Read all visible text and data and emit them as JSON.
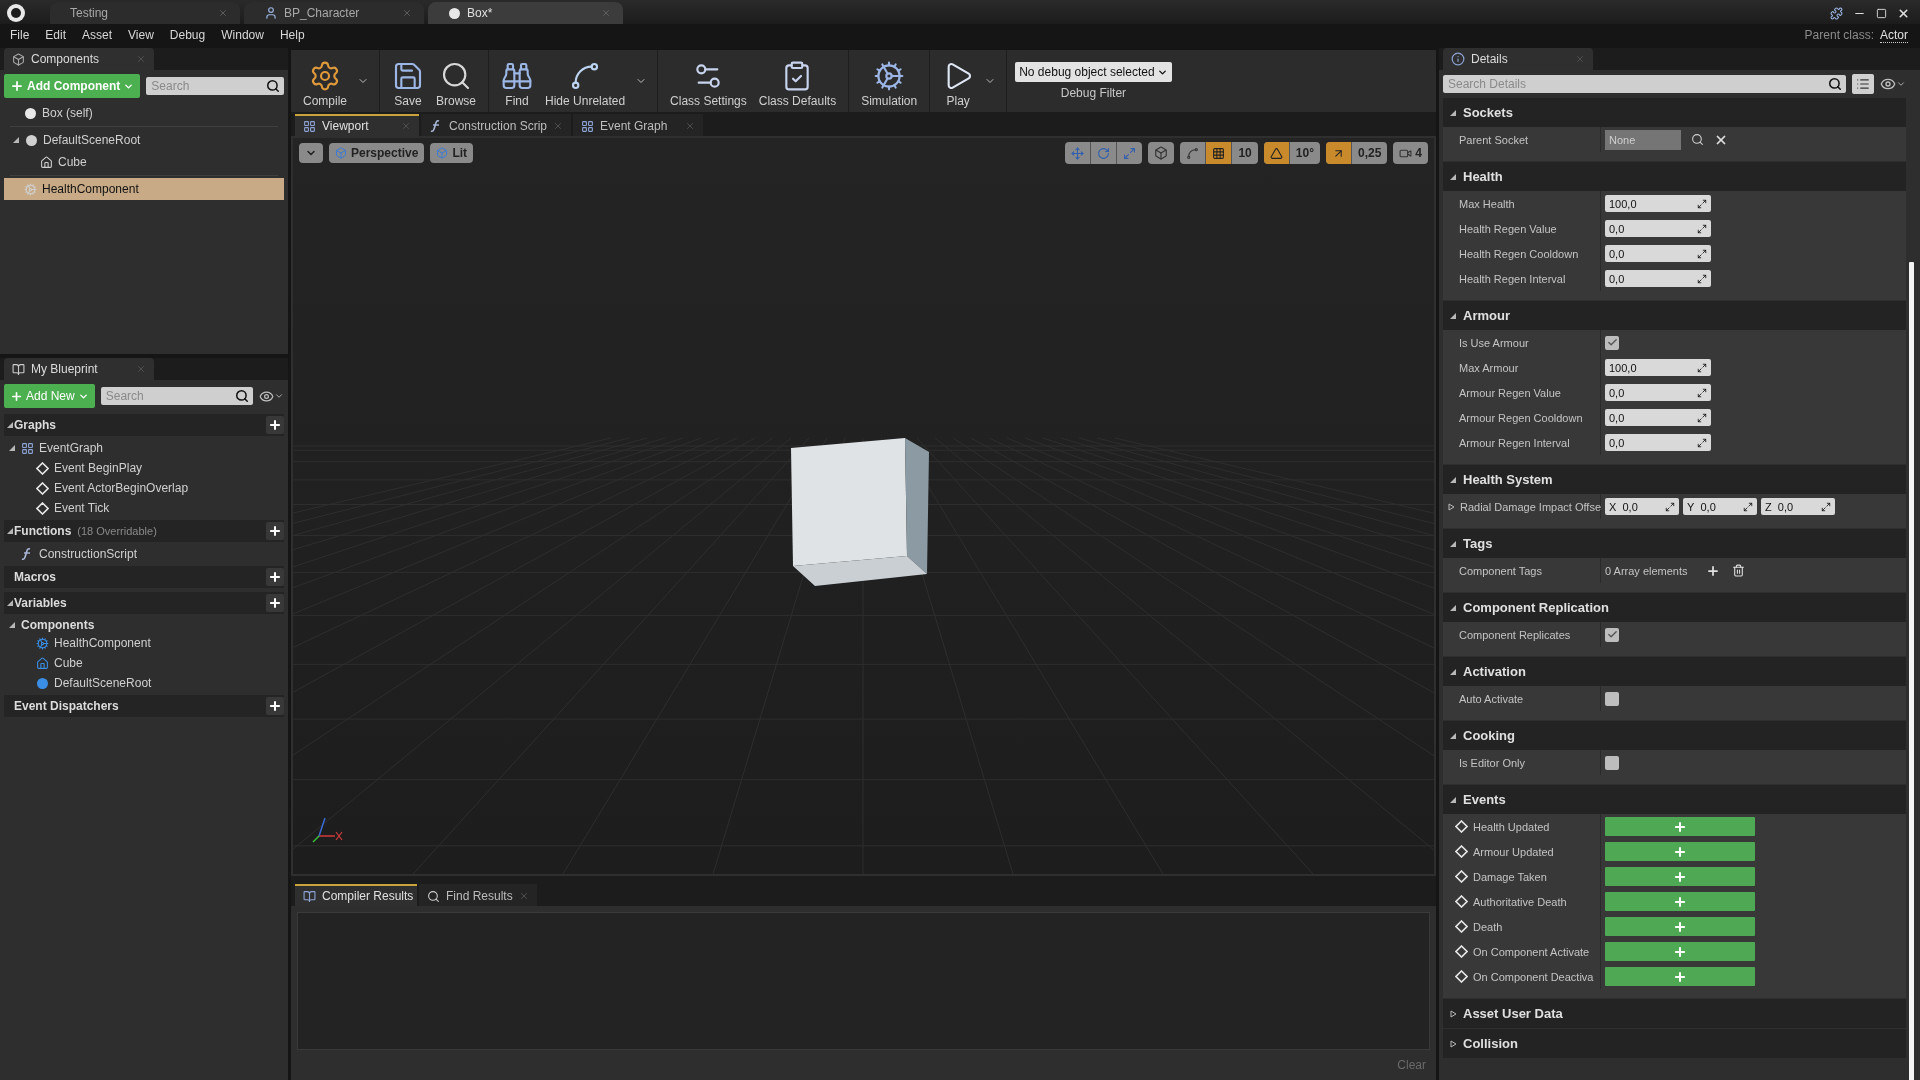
{
  "title_bar": {
    "tabs": [
      {
        "label": "Testing",
        "kind": "project",
        "selected": false
      },
      {
        "label": "BP_Character",
        "kind": "blueprint",
        "selected": false
      },
      {
        "label": "Box*",
        "kind": "asset",
        "selected": true
      }
    ]
  },
  "menu": [
    "File",
    "Edit",
    "Asset",
    "View",
    "Debug",
    "Window",
    "Help"
  ],
  "parent_class": {
    "label": "Parent class:",
    "value": "Actor"
  },
  "components_panel": {
    "tab": "Components",
    "add_button": "Add Component",
    "search_placeholder": "Search",
    "tree": [
      {
        "label": "Box (self)",
        "kind": "self",
        "selected": false
      },
      {
        "label": "DefaultSceneRoot",
        "kind": "scene",
        "selected": false,
        "expanded": true,
        "children": [
          {
            "label": "Cube",
            "kind": "mesh",
            "selected": false
          }
        ]
      },
      {
        "label": "HealthComponent",
        "kind": "component",
        "selected": true
      }
    ]
  },
  "my_blueprint": {
    "tab": "My Blueprint",
    "add_button": "Add New",
    "search_placeholder": "Search",
    "sections": [
      {
        "title": "Graphs",
        "expanded": true,
        "items": [
          {
            "label": "EventGraph",
            "kind": "graph",
            "expanded": true,
            "children": [
              {
                "label": "Event BeginPlay",
                "kind": "event"
              },
              {
                "label": "Event ActorBeginOverlap",
                "kind": "event"
              },
              {
                "label": "Event Tick",
                "kind": "event"
              }
            ]
          }
        ]
      },
      {
        "title": "Functions",
        "note": "(18 Overridable)",
        "expanded": true,
        "items": [
          {
            "label": "ConstructionScript",
            "kind": "function"
          }
        ]
      },
      {
        "title": "Macros"
      },
      {
        "title": "Variables",
        "expanded": true,
        "items": [
          {
            "label": "Components",
            "kind": "category",
            "expanded": true,
            "children": [
              {
                "label": "HealthComponent",
                "kind": "component"
              },
              {
                "label": "Cube",
                "kind": "mesh"
              },
              {
                "label": "DefaultSceneRoot",
                "kind": "scene"
              }
            ]
          }
        ]
      },
      {
        "title": "Event Dispatchers"
      }
    ]
  },
  "toolbar": {
    "groups": [
      {
        "buttons": [
          {
            "label": "Compile",
            "kind": "compile",
            "dropdown": true
          }
        ]
      },
      {
        "buttons": [
          {
            "label": "Save",
            "kind": "save"
          },
          {
            "label": "Browse",
            "kind": "browse"
          }
        ]
      },
      {
        "buttons": [
          {
            "label": "Find",
            "kind": "find"
          },
          {
            "label": "Hide Unrelated",
            "kind": "hide",
            "dropdown": true
          }
        ]
      },
      {
        "buttons": [
          {
            "label": "Class Settings",
            "kind": "settings"
          },
          {
            "label": "Class Defaults",
            "kind": "defaults"
          }
        ]
      },
      {
        "buttons": [
          {
            "label": "Simulation",
            "kind": "simulation"
          }
        ]
      },
      {
        "buttons": [
          {
            "label": "Play",
            "kind": "play",
            "dropdown": true
          }
        ]
      }
    ],
    "debug_select": "No debug object selected",
    "debug_label": "Debug Filter"
  },
  "doc_tabs": [
    {
      "label": "Viewport",
      "kind": "viewport",
      "selected": true
    },
    {
      "label": "Construction Scrip",
      "kind": "function",
      "selected": false
    },
    {
      "label": "Event Graph",
      "kind": "graph",
      "selected": false
    }
  ],
  "viewport": {
    "view_mode": "Perspective",
    "lighting": "Lit",
    "snaps": [
      {
        "kind": "grid",
        "value": "10",
        "on": true
      },
      {
        "kind": "rotation",
        "value": "10°",
        "on": true
      },
      {
        "kind": "scale",
        "value": "0,25",
        "on": true
      }
    ],
    "camera_speed": "4"
  },
  "bottom_panel": {
    "tabs": [
      {
        "label": "Compiler Results",
        "kind": "results",
        "selected": true
      },
      {
        "label": "Find Results",
        "kind": "find",
        "selected": false
      }
    ],
    "clear_button": "Clear"
  },
  "details": {
    "tab": "Details",
    "search_placeholder": "Search Details",
    "categories": [
      {
        "title": "Sockets",
        "expanded": true,
        "rows": [
          {
            "label": "Parent Socket",
            "kind": "socket",
            "placeholder": "None"
          }
        ]
      },
      {
        "title": "Health",
        "expanded": true,
        "rows": [
          {
            "label": "Max Health",
            "kind": "number",
            "value": "100,0"
          },
          {
            "label": "Health Regen Value",
            "kind": "number",
            "value": "0,0"
          },
          {
            "label": "Health Regen Cooldown",
            "kind": "number",
            "value": "0,0"
          },
          {
            "label": "Health Regen Interval",
            "kind": "number",
            "value": "0,0"
          }
        ]
      },
      {
        "title": "Armour",
        "expanded": true,
        "rows": [
          {
            "label": "Is Use Armour",
            "kind": "checkbox",
            "checked": true
          },
          {
            "label": "Max Armour",
            "kind": "number",
            "value": "100,0"
          },
          {
            "label": "Armour Regen Value",
            "kind": "number",
            "value": "0,0"
          },
          {
            "label": "Armour Regen Cooldown",
            "kind": "number",
            "value": "0,0"
          },
          {
            "label": "Armour Regen Interval",
            "kind": "number",
            "value": "0,0"
          }
        ]
      },
      {
        "title": "Health System",
        "expanded": true,
        "rows": [
          {
            "label": "Radial Damage Impact Offse",
            "kind": "vector",
            "expanded": false,
            "components": [
              {
                "axis": "X",
                "value": "0,0"
              },
              {
                "axis": "Y",
                "value": "0,0"
              },
              {
                "axis": "Z",
                "value": "0,0"
              }
            ]
          }
        ]
      },
      {
        "title": "Tags",
        "expanded": true,
        "rows": [
          {
            "label": "Component Tags",
            "kind": "array",
            "value": "0 Array elements"
          }
        ]
      },
      {
        "title": "Component Replication",
        "expanded": true,
        "rows": [
          {
            "label": "Component Replicates",
            "kind": "checkbox",
            "checked": true
          }
        ]
      },
      {
        "title": "Activation",
        "expanded": true,
        "rows": [
          {
            "label": "Auto Activate",
            "kind": "checkbox",
            "checked": false
          }
        ]
      },
      {
        "title": "Cooking",
        "expanded": true,
        "rows": [
          {
            "label": "Is Editor Only",
            "kind": "checkbox",
            "checked": false
          }
        ]
      },
      {
        "title": "Events",
        "expanded": true,
        "rows": [
          {
            "label": "Health Updated",
            "kind": "event"
          },
          {
            "label": "Armour Updated",
            "kind": "event"
          },
          {
            "label": "Damage Taken",
            "kind": "event"
          },
          {
            "label": "Authoritative Death",
            "kind": "event"
          },
          {
            "label": "Death",
            "kind": "event"
          },
          {
            "label": "On Component Activate",
            "kind": "event"
          },
          {
            "label": "On Component Deactiva",
            "kind": "event"
          }
        ]
      },
      {
        "title": "Asset User Data",
        "expanded": false
      },
      {
        "title": "Collision",
        "expanded": false
      }
    ]
  }
}
